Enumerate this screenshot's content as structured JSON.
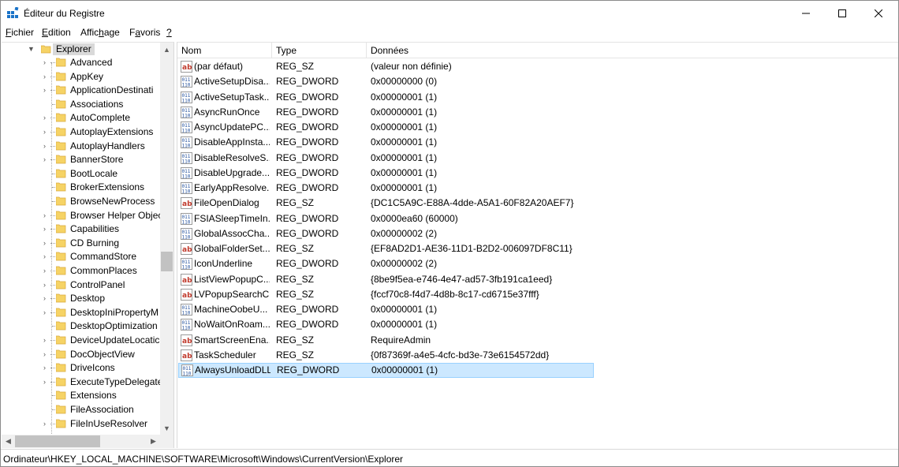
{
  "window": {
    "title": "Éditeur du Registre"
  },
  "menu": [
    {
      "pre": "",
      "key": "F",
      "post": "ichier"
    },
    {
      "pre": "",
      "key": "E",
      "post": "dition"
    },
    {
      "pre": "Affic",
      "key": "h",
      "post": "age"
    },
    {
      "pre": "F",
      "key": "a",
      "post": "voris"
    },
    {
      "pre": "",
      "key": "?",
      "post": ""
    }
  ],
  "tree": {
    "root": "Explorer",
    "items": [
      {
        "label": "Advanced",
        "expandable": true
      },
      {
        "label": "AppKey",
        "expandable": true
      },
      {
        "label": "ApplicationDestinati",
        "expandable": true
      },
      {
        "label": "Associations",
        "expandable": false
      },
      {
        "label": "AutoComplete",
        "expandable": true
      },
      {
        "label": "AutoplayExtensions",
        "expandable": true
      },
      {
        "label": "AutoplayHandlers",
        "expandable": true
      },
      {
        "label": "BannerStore",
        "expandable": true
      },
      {
        "label": "BootLocale",
        "expandable": false
      },
      {
        "label": "BrokerExtensions",
        "expandable": false
      },
      {
        "label": "BrowseNewProcess",
        "expandable": false
      },
      {
        "label": "Browser Helper Objec",
        "expandable": true
      },
      {
        "label": "Capabilities",
        "expandable": true
      },
      {
        "label": "CD Burning",
        "expandable": true
      },
      {
        "label": "CommandStore",
        "expandable": true
      },
      {
        "label": "CommonPlaces",
        "expandable": true
      },
      {
        "label": "ControlPanel",
        "expandable": true
      },
      {
        "label": "Desktop",
        "expandable": true
      },
      {
        "label": "DesktopIniPropertyM",
        "expandable": true
      },
      {
        "label": "DesktopOptimization",
        "expandable": false
      },
      {
        "label": "DeviceUpdateLocatic",
        "expandable": true
      },
      {
        "label": "DocObjectView",
        "expandable": true
      },
      {
        "label": "DriveIcons",
        "expandable": true
      },
      {
        "label": "ExecuteTypeDelegate",
        "expandable": true
      },
      {
        "label": "Extensions",
        "expandable": false
      },
      {
        "label": "FileAssociation",
        "expandable": false
      },
      {
        "label": "FileInUseResolver",
        "expandable": true
      }
    ]
  },
  "list": {
    "headers": {
      "name": "Nom",
      "type": "Type",
      "data": "Données"
    },
    "rows": [
      {
        "icon": "string",
        "name": "(par défaut)",
        "type": "REG_SZ",
        "data": "(valeur non définie)"
      },
      {
        "icon": "binary",
        "name": "ActiveSetupDisa...",
        "type": "REG_DWORD",
        "data": "0x00000000 (0)"
      },
      {
        "icon": "binary",
        "name": "ActiveSetupTask...",
        "type": "REG_DWORD",
        "data": "0x00000001 (1)"
      },
      {
        "icon": "binary",
        "name": "AsyncRunOnce",
        "type": "REG_DWORD",
        "data": "0x00000001 (1)"
      },
      {
        "icon": "binary",
        "name": "AsyncUpdatePC...",
        "type": "REG_DWORD",
        "data": "0x00000001 (1)"
      },
      {
        "icon": "binary",
        "name": "DisableAppInsta...",
        "type": "REG_DWORD",
        "data": "0x00000001 (1)"
      },
      {
        "icon": "binary",
        "name": "DisableResolveS...",
        "type": "REG_DWORD",
        "data": "0x00000001 (1)"
      },
      {
        "icon": "binary",
        "name": "DisableUpgrade...",
        "type": "REG_DWORD",
        "data": "0x00000001 (1)"
      },
      {
        "icon": "binary",
        "name": "EarlyAppResolve...",
        "type": "REG_DWORD",
        "data": "0x00000001 (1)"
      },
      {
        "icon": "string",
        "name": "FileOpenDialog",
        "type": "REG_SZ",
        "data": "{DC1C5A9C-E88A-4dde-A5A1-60F82A20AEF7}"
      },
      {
        "icon": "binary",
        "name": "FSIASleepTimeIn...",
        "type": "REG_DWORD",
        "data": "0x0000ea60 (60000)"
      },
      {
        "icon": "binary",
        "name": "GlobalAssocCha...",
        "type": "REG_DWORD",
        "data": "0x00000002 (2)"
      },
      {
        "icon": "string",
        "name": "GlobalFolderSet...",
        "type": "REG_SZ",
        "data": "{EF8AD2D1-AE36-11D1-B2D2-006097DF8C11}"
      },
      {
        "icon": "binary",
        "name": "IconUnderline",
        "type": "REG_DWORD",
        "data": "0x00000002 (2)"
      },
      {
        "icon": "string",
        "name": "ListViewPopupC...",
        "type": "REG_SZ",
        "data": "{8be9f5ea-e746-4e47-ad57-3fb191ca1eed}"
      },
      {
        "icon": "string",
        "name": "LVPopupSearchC...",
        "type": "REG_SZ",
        "data": "{fccf70c8-f4d7-4d8b-8c17-cd6715e37fff}"
      },
      {
        "icon": "binary",
        "name": "MachineOobeU...",
        "type": "REG_DWORD",
        "data": "0x00000001 (1)"
      },
      {
        "icon": "binary",
        "name": "NoWaitOnRoam...",
        "type": "REG_DWORD",
        "data": "0x00000001 (1)"
      },
      {
        "icon": "string",
        "name": "SmartScreenEna...",
        "type": "REG_SZ",
        "data": "RequireAdmin"
      },
      {
        "icon": "string",
        "name": "TaskScheduler",
        "type": "REG_SZ",
        "data": "{0f87369f-a4e5-4cfc-bd3e-73e6154572dd}"
      },
      {
        "icon": "binary",
        "name": "AlwaysUnloadDLL",
        "type": "REG_DWORD",
        "data": "0x00000001 (1)",
        "selected": true
      }
    ]
  },
  "status": {
    "path": "Ordinateur\\HKEY_LOCAL_MACHINE\\SOFTWARE\\Microsoft\\Windows\\CurrentVersion\\Explorer"
  },
  "colors": {
    "selection": "#cce8ff",
    "selection_border": "#99d1ff",
    "folder": "#f6d365",
    "string_icon": "#c0392b",
    "binary_icon": "#1f4e9c"
  }
}
